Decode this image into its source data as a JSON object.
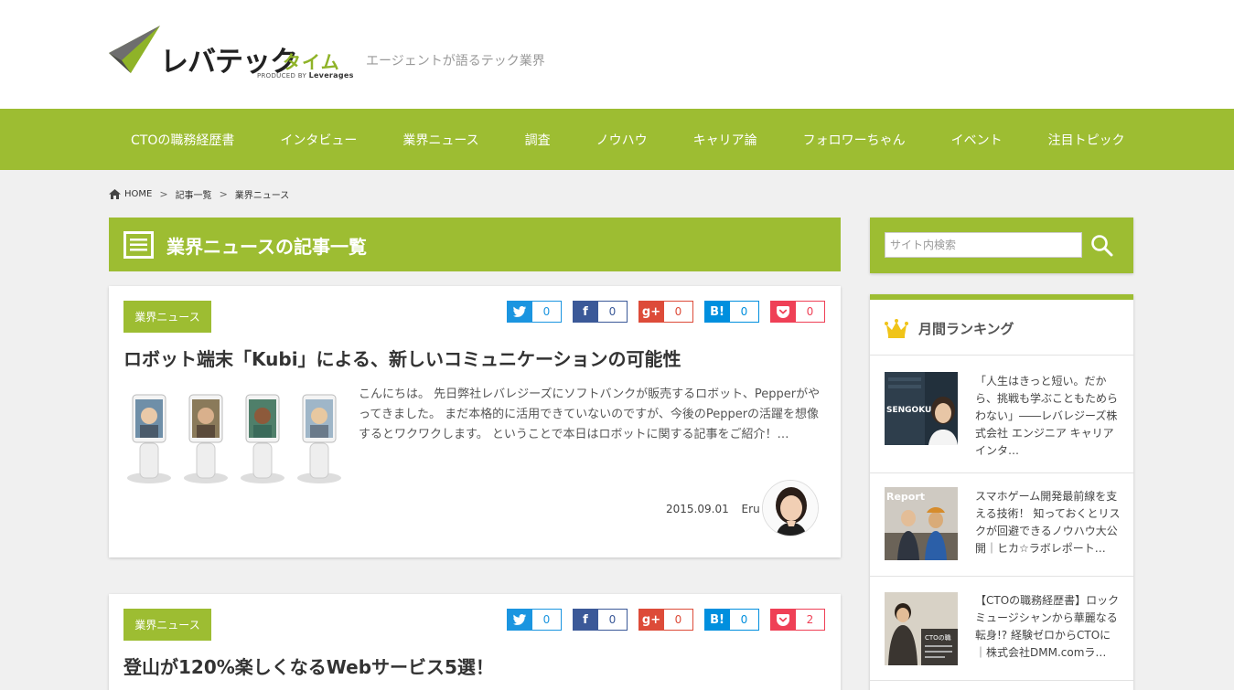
{
  "header": {
    "logo_text": "レバテック",
    "logo_sub": "タイム",
    "logo_produced": "PRODUCED BY",
    "logo_brand": "Leverages",
    "tagline": "エージェントが語るテック業界"
  },
  "nav": {
    "items": [
      "CTOの職務経歴書",
      "インタビュー",
      "業界ニュース",
      "調査",
      "ノウハウ",
      "キャリア論",
      "フォロワーちゃん",
      "イベント",
      "注目トピック"
    ]
  },
  "breadcrumb": {
    "home": "HOME",
    "sep": ">",
    "list": "記事一覧",
    "current": "業界ニュース"
  },
  "section": {
    "title": "業界ニュースの記事一覧"
  },
  "share_icons": {
    "twitter": "t",
    "facebook": "f",
    "google": "g+",
    "hatena": "B!"
  },
  "articles": [
    {
      "category": "業界ニュース",
      "title": "ロボット端末「Kubi」による、新しいコミュニケーションの可能性",
      "counts": {
        "twitter": "0",
        "facebook": "0",
        "google": "0",
        "hatena": "0",
        "pocket": "0"
      },
      "excerpt": "こんにちは。 先日弊社レバレジーズにソフトバンクが販売するロボット、Pepperがやってきました。 まだ本格的に活用できていないのですが、今後のPepperの活躍を想像するとワクワクします。 ということで本日はロボットに関する記事をご紹介！…",
      "date": "2015.09.01",
      "author": "Eru"
    },
    {
      "category": "業界ニュース",
      "title": "登山が120%楽しくなるWebサービス5選！",
      "counts": {
        "twitter": "0",
        "facebook": "0",
        "google": "0",
        "hatena": "0",
        "pocket": "2"
      }
    }
  ],
  "sidebar": {
    "search_placeholder": "サイト内検索",
    "ranking_title": "月間ランキング",
    "ranking": [
      {
        "text": "「人生はきっと短い。だから、挑戦も学ぶこともためらわない」――レバレジーズ株式会社 エンジニア キャリアインタ…",
        "thumb_label": "SENGOKU"
      },
      {
        "text": "スマホゲーム開発最前線を支える技術！ 知っておくとリスクが回避できるノウハウ大公開｜ヒカ☆ラボレポート…",
        "thumb_label": "Report"
      },
      {
        "text": "【CTOの職務経歴書】ロックミュージシャンから華麗なる転身!? 経験ゼロからCTOに｜株式会社DMM.comラ…",
        "thumb_label": "CTOの職"
      }
    ]
  },
  "colors": {
    "brand_green": "#9dbd32",
    "twitter": "#1b95e0",
    "facebook": "#3b5998",
    "google": "#dd4b39",
    "hatena": "#008fde",
    "pocket": "#ef4056"
  }
}
